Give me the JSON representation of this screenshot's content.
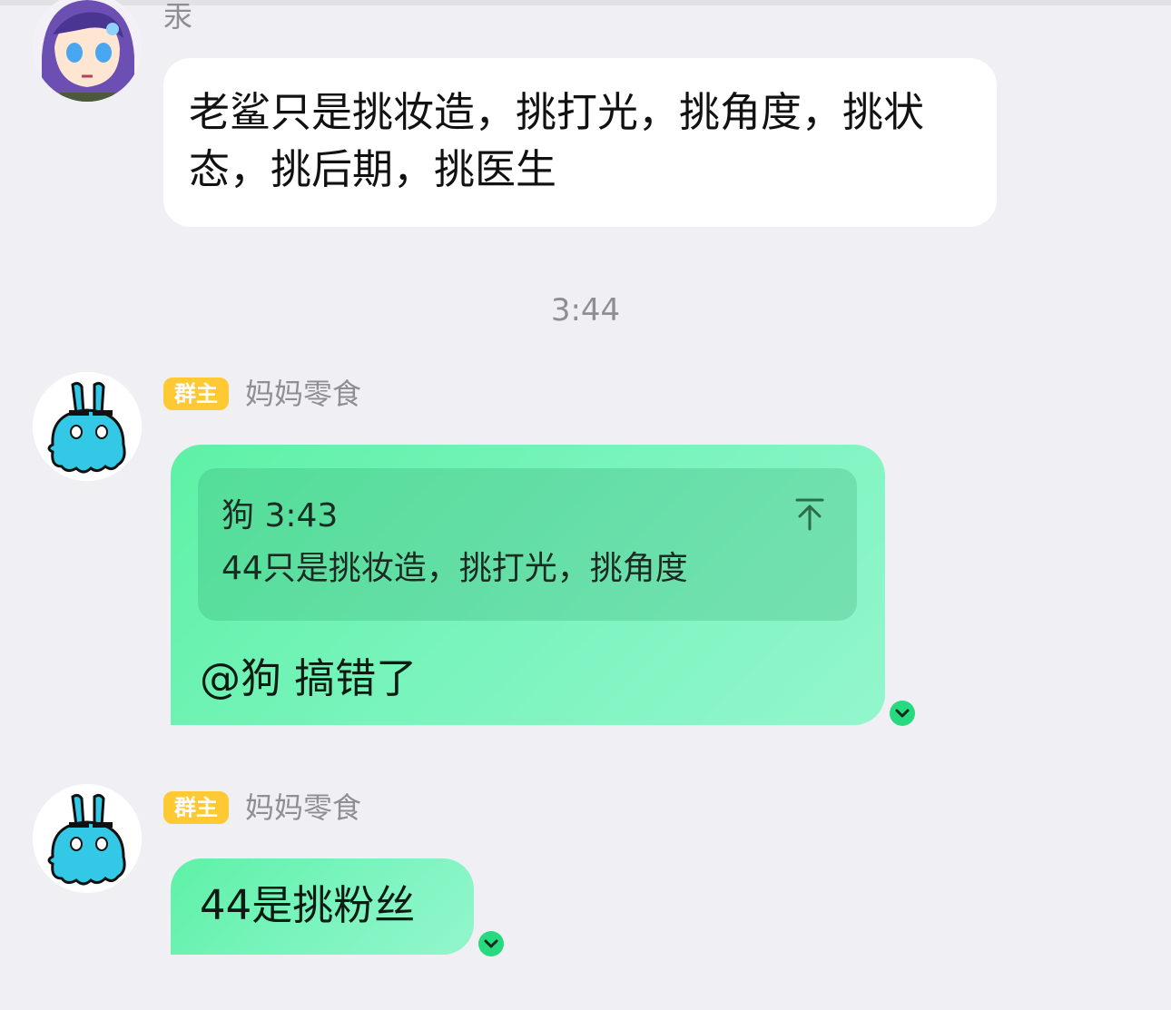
{
  "message_1": {
    "sender_partial": "汞",
    "text": "老鲨只是挑妆造，挑打光，挑角度，挑状态，挑后期，挑医生"
  },
  "time_divider": "3:44",
  "message_2": {
    "badge": "群主",
    "sender": "妈妈零食",
    "quote": {
      "author": "狗",
      "time": "3:43",
      "text": "44只是挑妆造，挑打光，挑角度"
    },
    "text": "@狗 搞错了"
  },
  "message_3": {
    "badge": "群主",
    "sender": "妈妈零食",
    "text": "44是挑粉丝"
  },
  "icons": {
    "quote_jump": "arrow-to-top-icon",
    "expand": "chevron-down-icon"
  },
  "colors": {
    "background": "#f0eff3",
    "bubble_green": "#7cf4bf",
    "badge": "#ffc933",
    "expand_button": "#27d97f"
  }
}
